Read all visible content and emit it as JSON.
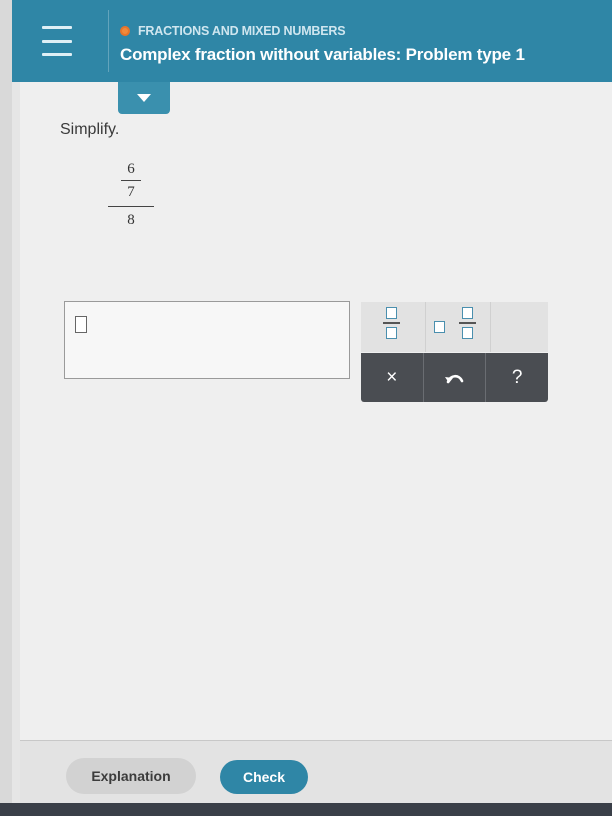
{
  "header": {
    "topic": "FRACTIONS AND MIXED NUMBERS",
    "title": "Complex fraction without variables: Problem type 1"
  },
  "problem": {
    "instruction": "Simplify.",
    "numerator": {
      "top": "6",
      "bottom": "7"
    },
    "denominator": "8"
  },
  "toolbar": {
    "clear_label": "×",
    "help_label": "?"
  },
  "footer": {
    "explanation_label": "Explanation",
    "check_label": "Check"
  },
  "colors": {
    "header": "#2f86a6",
    "accent_orange": "#e8742a",
    "toolbar_dark": "#4a4d52"
  }
}
